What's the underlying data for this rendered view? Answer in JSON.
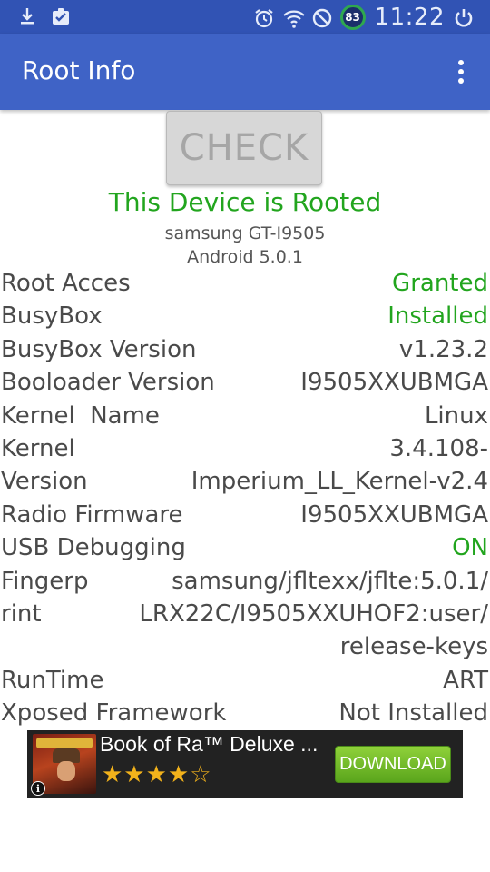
{
  "status_bar": {
    "icons_left": [
      "download-icon",
      "clipboard-check-icon"
    ],
    "icons_right": [
      "alarm-icon",
      "wifi-icon",
      "do-not-disturb-icon",
      "battery-icon",
      "power-icon"
    ],
    "battery": "83",
    "time": "11:22"
  },
  "app_bar": {
    "title": "Root Info",
    "menu_icon": "more-vert-icon"
  },
  "check_button": "CHECK",
  "status": {
    "rooted": "This Device is Rooted",
    "device_model": "samsung GT-I9505",
    "android_version": "Android 5.0.1"
  },
  "info_rows": [
    {
      "key": "Root Acces",
      "value": "Granted"
    },
    {
      "key": "BusyBox",
      "value": "Installed"
    },
    {
      "key": "BusyBox Version",
      "value": "v1.23.2"
    },
    {
      "key": "Booloader Version",
      "value": "I9505XXUBMGA"
    },
    {
      "key": "Kernel  Name",
      "value": "Linux"
    },
    {
      "key": "Kernel\nVersion",
      "value": "3.4.108-\nImperium_LL_Kernel-v2.4"
    },
    {
      "key": "Radio Firmware",
      "value": "I9505XXUBMGA"
    },
    {
      "key": "USB Debugging",
      "value": "ON"
    },
    {
      "key": "Fingerp\nrint",
      "value": "samsung/jfltexx/jflte:5.0.1/\nLRX22C/I9505XXUHOF2:user/\nrelease-keys"
    },
    {
      "key": "RunTime",
      "value": "ART"
    },
    {
      "key": "Xposed Framework",
      "value": "Not Installed"
    }
  ],
  "ad": {
    "title": "Book of Ra™ Deluxe ...",
    "rating": "★★★★☆",
    "button": "DOWNLOAD",
    "info_icon": "info-icon"
  },
  "colors": {
    "status_bar": "#3153b4",
    "app_bar": "#3f63c6",
    "green": "#22a51e",
    "text": "#4a4a4a"
  }
}
